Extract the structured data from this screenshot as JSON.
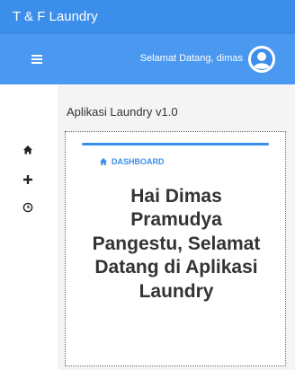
{
  "app": {
    "title": "T & F Laundry"
  },
  "navbar": {
    "welcome_text": "Selamat Datang, dimas",
    "menu_icon": "hamburger-menu-icon",
    "avatar_icon": "user-avatar-icon"
  },
  "sidebar": {
    "items": [
      {
        "icon": "home-icon"
      },
      {
        "icon": "plus-icon"
      },
      {
        "icon": "history-icon"
      }
    ]
  },
  "main": {
    "app_title": "Aplikasi Laundry v1.0",
    "card": {
      "label": "DASHBOARD",
      "label_icon": "home-icon",
      "greeting": "Hai Dimas Pramudya Pangestu, Selamat Datang di Aplikasi Laundry"
    }
  },
  "colors": {
    "primary": "#3b8eea",
    "navbar": "#4a98f0",
    "content_bg": "#f4f4f4",
    "text": "#333333"
  }
}
